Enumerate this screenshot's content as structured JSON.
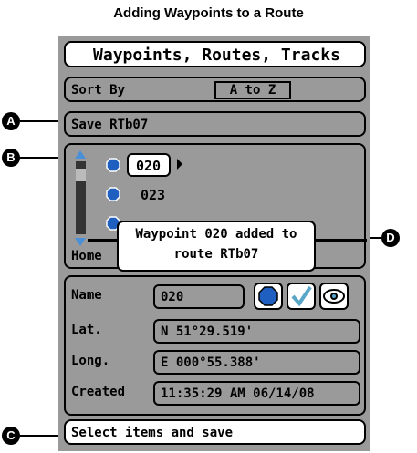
{
  "caption": "Adding Waypoints to a Route",
  "screen": {
    "title": "Waypoints, Routes, Tracks",
    "sort_by": {
      "label": "Sort By",
      "value": "A to Z"
    },
    "save_label": "Save RTb07",
    "list": {
      "items": [
        {
          "label": "020",
          "selected": true
        },
        {
          "label": "023"
        }
      ],
      "bottom_label": "Home"
    },
    "details": {
      "name_label": "Name",
      "name_value": "020",
      "lat_label": "Lat.",
      "lat_value": "N 51°29.519'",
      "long_label": "Long.",
      "long_value": "E 000°55.388'",
      "created_label": "Created",
      "created_value": "11:35:29 AM 06/14/08",
      "icons": [
        "waypoint-symbol-icon",
        "checkmark-icon",
        "eye-icon"
      ]
    },
    "status": "Select items and save",
    "popup": {
      "line1": "Waypoint 020 added to",
      "line2": "route RTb07"
    }
  },
  "callouts": {
    "a": "A",
    "b": "B",
    "c": "C",
    "d": "D"
  },
  "colors": {
    "screen_bg": "#9a9a9a",
    "icon_blue": "#1e5fbf",
    "check_teal": "#5aa6c8"
  }
}
